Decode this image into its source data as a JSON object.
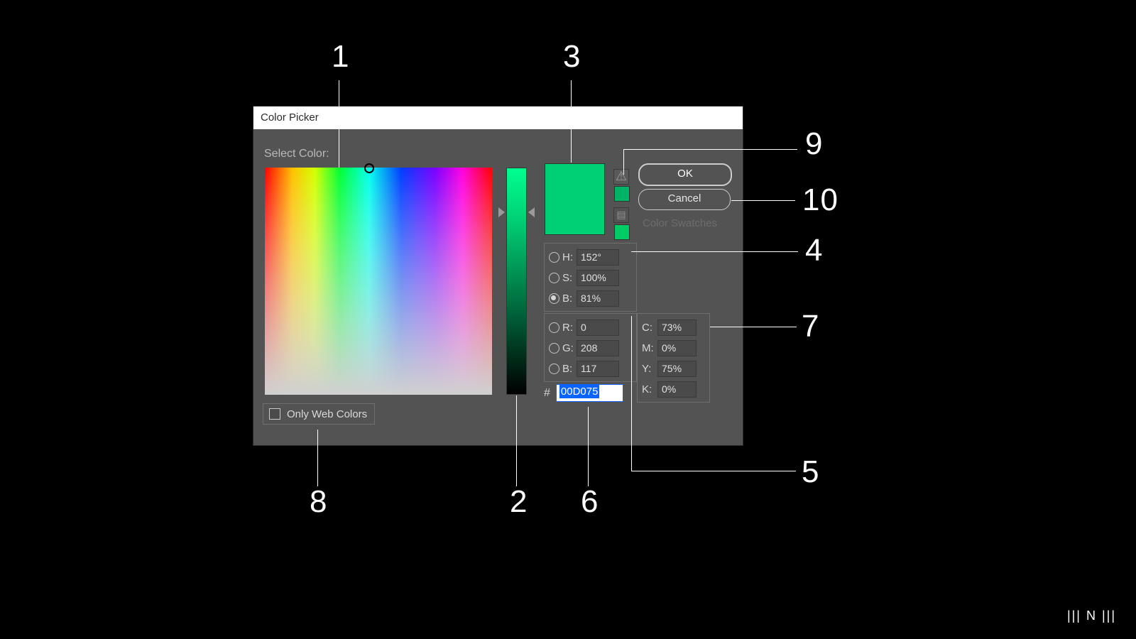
{
  "dialog": {
    "title": "Color Picker",
    "select_label": "Select Color:",
    "only_web_label": "Only Web Colors",
    "buttons": {
      "ok": "OK",
      "cancel": "Cancel",
      "swatches": "Color Swatches"
    },
    "hex": {
      "value": "00D075"
    },
    "hsb": {
      "h_label": "H:",
      "h": "152°",
      "s_label": "S:",
      "s": "100%",
      "b_label": "B:",
      "b": "81%"
    },
    "rgb": {
      "r_label": "R:",
      "r": "0",
      "g_label": "G:",
      "g": "208",
      "b_label": "B:",
      "b": "117"
    },
    "cmyk": {
      "c_label": "C:",
      "c": "73%",
      "m_label": "M:",
      "m": "0%",
      "y_label": "Y:",
      "y": "75%",
      "k_label": "K:",
      "k": "0%"
    },
    "color": {
      "current": "#00D075",
      "previous": "#00D075",
      "cube_swatch": "#00c26b"
    }
  },
  "callouts": {
    "n1": "1",
    "n2": "2",
    "n3": "3",
    "n4": "4",
    "n5": "5",
    "n6": "6",
    "n7": "7",
    "n8": "8",
    "n9": "9",
    "n10": "10"
  },
  "logo": "||| N |||"
}
